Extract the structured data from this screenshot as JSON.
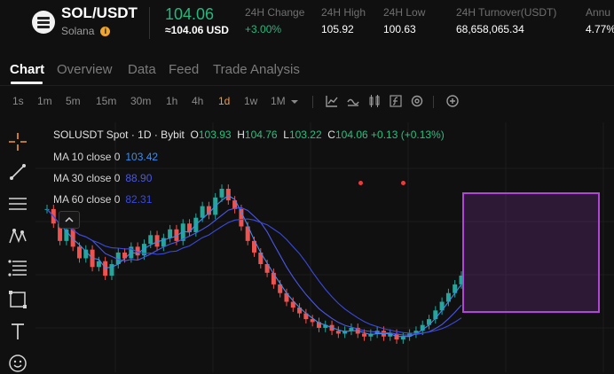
{
  "ticker": {
    "pair": "SOL/USDT",
    "name": "Solana",
    "last_price": "104.06",
    "fiat_price": "≈104.06 USD",
    "stats": [
      {
        "label": "24H Change",
        "value": "+3.00%",
        "positive": true
      },
      {
        "label": "24H High",
        "value": "105.92",
        "positive": false
      },
      {
        "label": "24H Low",
        "value": "100.63",
        "positive": false
      },
      {
        "label": "24H Turnover(USDT)",
        "value": "68,658,065.34",
        "positive": false
      },
      {
        "label": "Annu",
        "value": "4.77%",
        "positive": false
      }
    ]
  },
  "tabs": [
    "Chart",
    "Overview",
    "Data",
    "Feed",
    "Trade Analysis"
  ],
  "active_tab": "Chart",
  "timeframes": [
    "1s",
    "1m",
    "5m",
    "15m",
    "30m",
    "1h",
    "4h",
    "1d",
    "1w",
    "1M"
  ],
  "active_timeframe": "1d",
  "toolbar_icons": [
    "indicators-icon",
    "chart-style-icon",
    "candle-type-icon",
    "formula-icon",
    "settings-icon",
    "add-icon"
  ],
  "drawing_tools": [
    "crosshair-icon",
    "trend-line-icon",
    "horizontal-lines-icon",
    "pattern-icon",
    "fib-icon",
    "shape-icon",
    "text-icon",
    "emoji-icon"
  ],
  "legend": {
    "symbol": "SOLUSDT Spot · 1D · Bybit",
    "open": "103.93",
    "high": "104.76",
    "low": "103.22",
    "close": "104.06",
    "change": "+0.13 (+0.13%)"
  },
  "moving_averages": [
    {
      "label": "MA 10 close 0",
      "value": "103.42",
      "color": "#3b8df0"
    },
    {
      "label": "MA 30 close 0",
      "value": "88.90",
      "color": "#4a57e8"
    },
    {
      "label": "MA 60 close 0",
      "value": "82.31",
      "color": "#3a4ae0"
    }
  ],
  "colors": {
    "up": "#26a69a",
    "down": "#ef5350",
    "accent": "#f39a31",
    "price": "#25b87d",
    "rectangle": "#b145d6"
  },
  "chart_data": {
    "type": "candlestick",
    "timeframe": "1D",
    "series": [
      {
        "name": "SOLUSDT",
        "values": [
          150,
          140,
          128,
          136,
          124,
          116,
          122,
          110,
          114,
          104,
          112,
          120,
          116,
          124,
          118,
          126,
          132,
          124,
          130,
          136,
          128,
          140,
          134,
          144,
          152,
          146,
          158,
          164,
          156,
          150,
          138,
          128,
          120,
          112,
          106,
          98,
          92,
          86,
          82,
          78,
          74,
          72,
          68,
          70,
          66,
          64,
          66,
          68,
          64,
          62,
          64,
          66,
          62,
          64,
          60,
          62,
          64,
          66,
          70,
          74,
          80,
          86,
          92,
          98,
          104.06
        ]
      }
    ]
  }
}
